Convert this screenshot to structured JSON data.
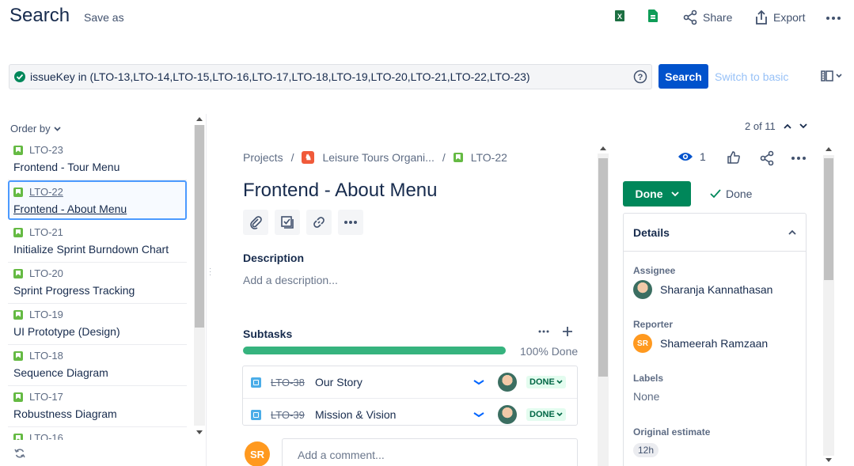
{
  "header": {
    "title": "Search",
    "save_as": "Save as",
    "share_label": "Share",
    "export_label": "Export",
    "excel_icon": "excel-icon",
    "sheets_icon": "google-sheets-icon"
  },
  "jql": {
    "query": "issueKey in (LTO-13,LTO-14,LTO-15,LTO-16,LTO-17,LTO-18,LTO-19,LTO-20,LTO-21,LTO-22,LTO-23)",
    "search_label": "Search",
    "switch_label": "Switch to basic"
  },
  "list": {
    "order_by": "Order by",
    "items": [
      {
        "key": "LTO-23",
        "summary": "Frontend - Tour Menu"
      },
      {
        "key": "LTO-22",
        "summary": "Frontend - About Menu"
      },
      {
        "key": "LTO-21",
        "summary": "Initialize Sprint Burndown Chart"
      },
      {
        "key": "LTO-20",
        "summary": "Sprint Progress Tracking"
      },
      {
        "key": "LTO-19",
        "summary": "UI Prototype (Design)"
      },
      {
        "key": "LTO-18",
        "summary": "Sequence Diagram"
      },
      {
        "key": "LTO-17",
        "summary": "Robustness Diagram"
      },
      {
        "key": "LTO-16",
        "summary": ""
      }
    ]
  },
  "pager": {
    "text": "2 of 11"
  },
  "issue": {
    "crumb_projects": "Projects",
    "crumb_project": "Leisure Tours Organi...",
    "crumb_key": "LTO-22",
    "title": "Frontend - About Menu",
    "description_label": "Description",
    "description_placeholder": "Add a description...",
    "subtasks_label": "Subtasks",
    "progress_text": "100% Done",
    "progress_fraction": 1.0,
    "subtasks": [
      {
        "key": "LTO-38",
        "summary": "Our Story",
        "status": "DONE"
      },
      {
        "key": "LTO-39",
        "summary": "Mission & Vision",
        "status": "DONE"
      }
    ],
    "comment_avatar": "SR",
    "comment_placeholder": "Add a comment..."
  },
  "side": {
    "watch_count": "1",
    "status_label": "Done",
    "resolution_label": "Done",
    "details_label": "Details",
    "assignee_label": "Assignee",
    "assignee": "Sharanja Kannathasan",
    "reporter_label": "Reporter",
    "reporter_initials": "SR",
    "reporter": "Shameerah Ramzaan",
    "labels_label": "Labels",
    "labels_value": "None",
    "estimate_label": "Original estimate",
    "estimate_value": "12h"
  }
}
